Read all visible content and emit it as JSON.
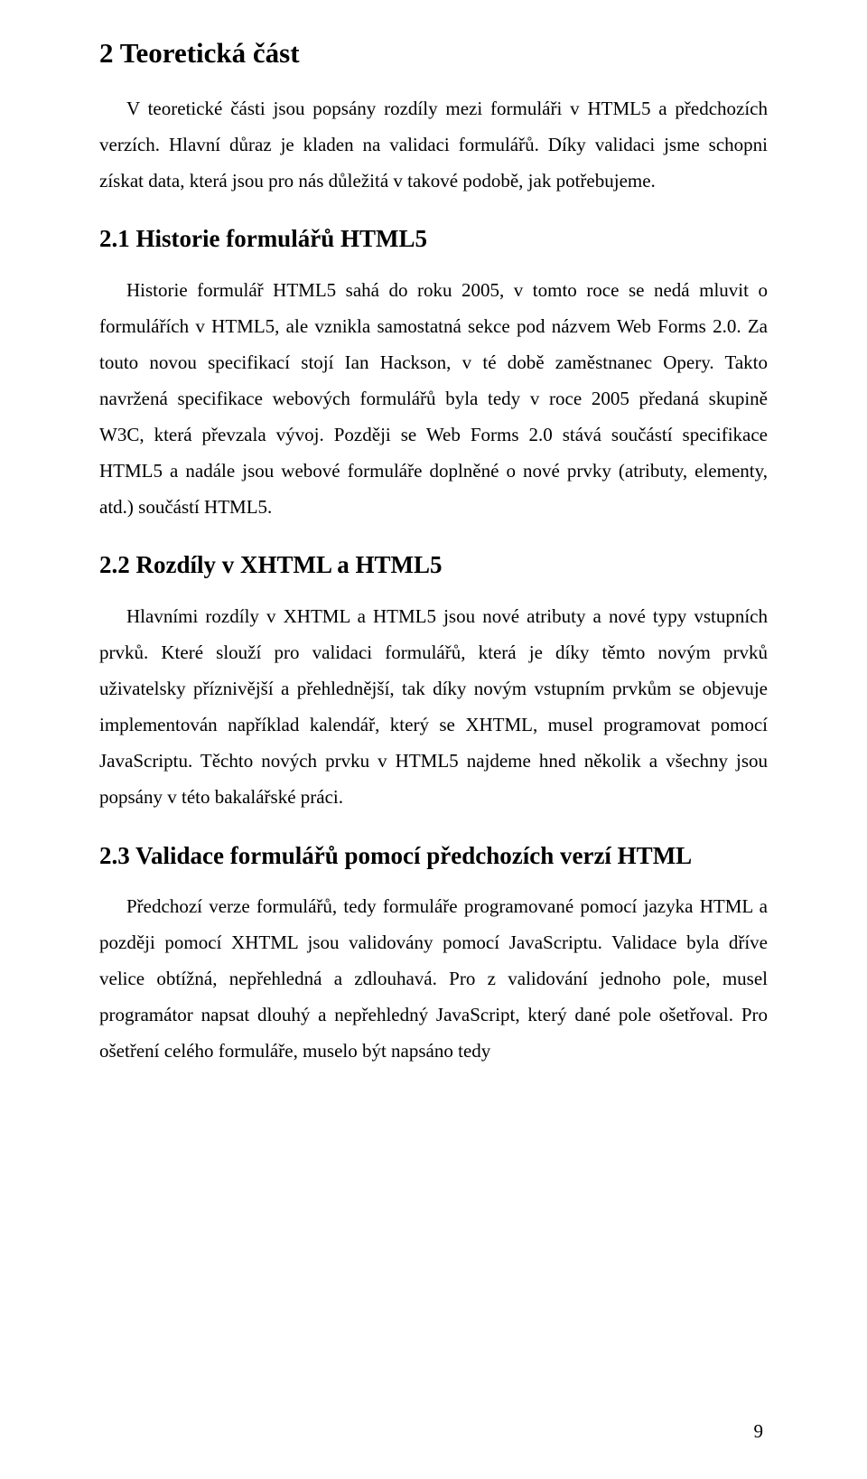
{
  "section2": {
    "heading": "2  Teoretická část",
    "p1": "V teoretické části jsou popsány rozdíly mezi formuláři v HTML5 a předchozích verzích. Hlavní důraz je kladen na validaci formulářů. Díky validaci jsme schopni získat data, která jsou pro nás důležitá v takové podobě, jak potřebujeme."
  },
  "section21": {
    "heading": "2.1  Historie formulářů HTML5",
    "p1": "Historie formulář HTML5 sahá do roku 2005, v tomto roce se nedá mluvit o formulářích v HTML5, ale vznikla samostatná sekce pod názvem Web Forms 2.0. Za touto novou specifikací stojí Ian Hackson, v té době zaměstnanec Opery. Takto navržená specifikace webových formulářů byla tedy v roce 2005 předaná skupině W3C, která převzala vývoj. Později se Web Forms 2.0 stává součástí specifikace HTML5 a nadále jsou webové formuláře doplněné o nové prvky (atributy, elementy, atd.) součástí HTML5."
  },
  "section22": {
    "heading": "2.2  Rozdíly v XHTML a HTML5",
    "p1": "Hlavními rozdíly v XHTML a HTML5 jsou nové atributy a nové typy vstupních prvků. Které slouží pro validaci formulářů, která je díky těmto novým prvků uživatelsky příznivější a přehlednější, tak díky novým vstupním prvkům se objevuje implementován například kalendář, který se XHTML, musel programovat pomocí JavaScriptu. Těchto nových prvku v HTML5 najdeme hned několik a všechny jsou popsány v této bakalářské práci."
  },
  "section23": {
    "heading": "2.3  Validace formulářů pomocí předchozích verzí HTML",
    "p1": "Předchozí verze formulářů, tedy formuláře programované pomocí jazyka HTML a později pomocí XHTML jsou validovány pomocí JavaScriptu. Validace byla dříve velice obtížná, nepřehledná a zdlouhavá. Pro z validování jednoho pole, musel programátor napsat dlouhý a nepřehledný JavaScript, který dané pole ošetřoval. Pro ošetření celého formuláře, muselo být napsáno tedy"
  },
  "pageNumber": "9"
}
